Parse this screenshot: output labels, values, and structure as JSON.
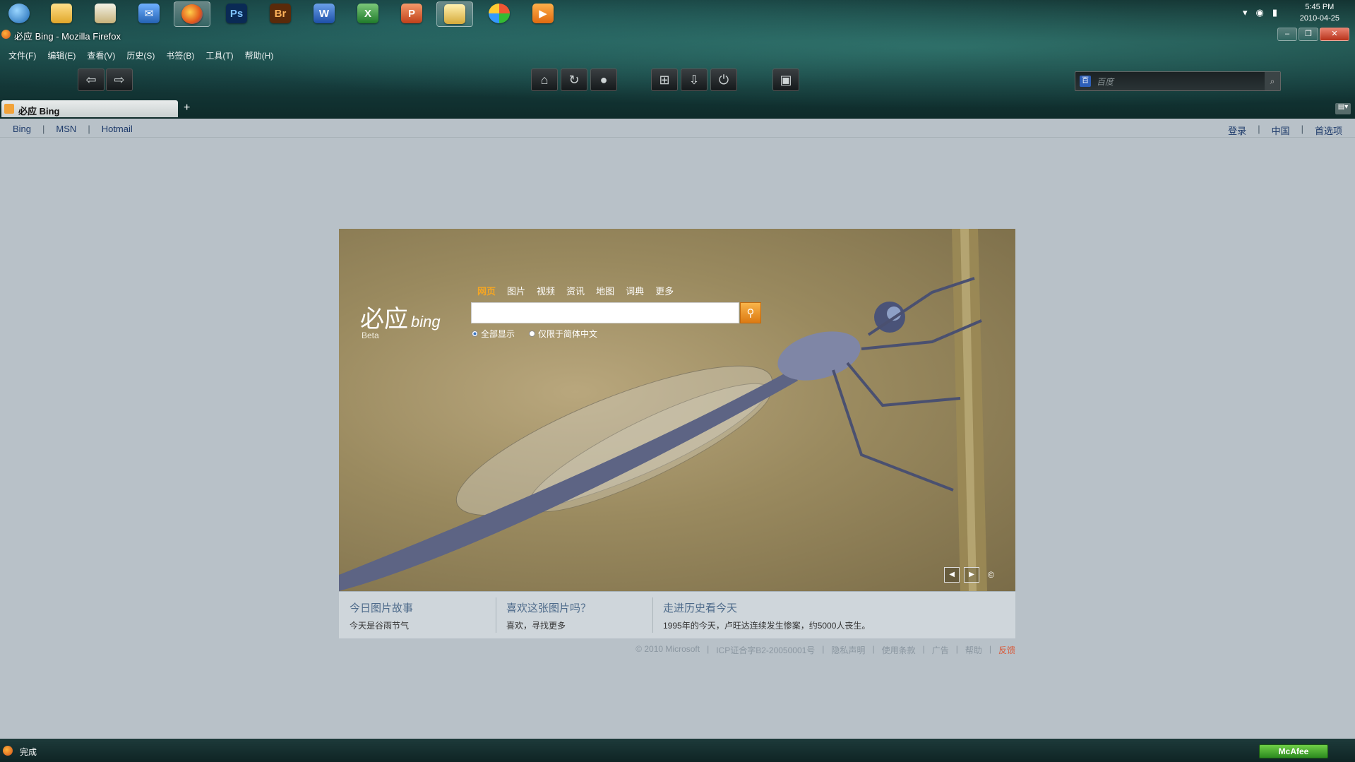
{
  "taskbar": {
    "apps": [
      {
        "name": "start-orb",
        "label": ""
      },
      {
        "name": "folder",
        "label": ""
      },
      {
        "name": "files",
        "label": ""
      },
      {
        "name": "email",
        "label": ""
      },
      {
        "name": "firefox",
        "label": ""
      },
      {
        "name": "photoshop",
        "label": "Ps"
      },
      {
        "name": "bridge",
        "label": "Br"
      },
      {
        "name": "word",
        "label": "W"
      },
      {
        "name": "excel",
        "label": "X"
      },
      {
        "name": "powerpoint",
        "label": "P"
      },
      {
        "name": "explorer",
        "label": ""
      },
      {
        "name": "media-center",
        "label": ""
      },
      {
        "name": "media-player",
        "label": "▶"
      }
    ],
    "clock_time": "5:45 PM",
    "clock_date": "2010-04-25"
  },
  "window": {
    "title": "必应 Bing - Mozilla Firefox"
  },
  "menu": [
    "文件(F)",
    "编辑(E)",
    "查看(V)",
    "历史(S)",
    "书签(B)",
    "工具(T)",
    "帮助(H)"
  ],
  "toolbar": {
    "search_placeholder": "百度"
  },
  "tab": {
    "title": "必应 Bing",
    "new_tab": "+"
  },
  "bing_top": {
    "left": [
      "Bing",
      "MSN",
      "Hotmail"
    ],
    "right": [
      "登录",
      "中国",
      "首选项"
    ]
  },
  "logo": {
    "cn": "必应",
    "en": "bing",
    "beta": "Beta"
  },
  "scopes": [
    "网页",
    "图片",
    "视频",
    "资讯",
    "地图",
    "词典",
    "更多"
  ],
  "search": {
    "value": "",
    "radio_all": "全部显示",
    "radio_cn": "仅限于简体中文"
  },
  "hero_nav": {
    "prev": "◀",
    "next": "▶",
    "copyright": "©"
  },
  "info": [
    {
      "title": "今日图片故事",
      "sub": "今天是谷雨节气"
    },
    {
      "title": "喜欢这张图片吗？",
      "sub": "喜欢，寻找更多"
    },
    {
      "title": "走进历史看今天",
      "sub": "1995年的今天，卢旺达连续发生惨案，约5000人丧生。"
    }
  ],
  "footer": [
    "© 2010 Microsoft",
    "ICP证合字B2-20050001号",
    "隐私声明",
    "使用条款",
    "广告",
    "帮助",
    "反馈"
  ],
  "status": {
    "text": "完成",
    "mcafee": "McAfee"
  },
  "colors": {
    "accent": "#f5a623",
    "link": "#1d3a6a",
    "page_bg": "#b8c1c8"
  }
}
